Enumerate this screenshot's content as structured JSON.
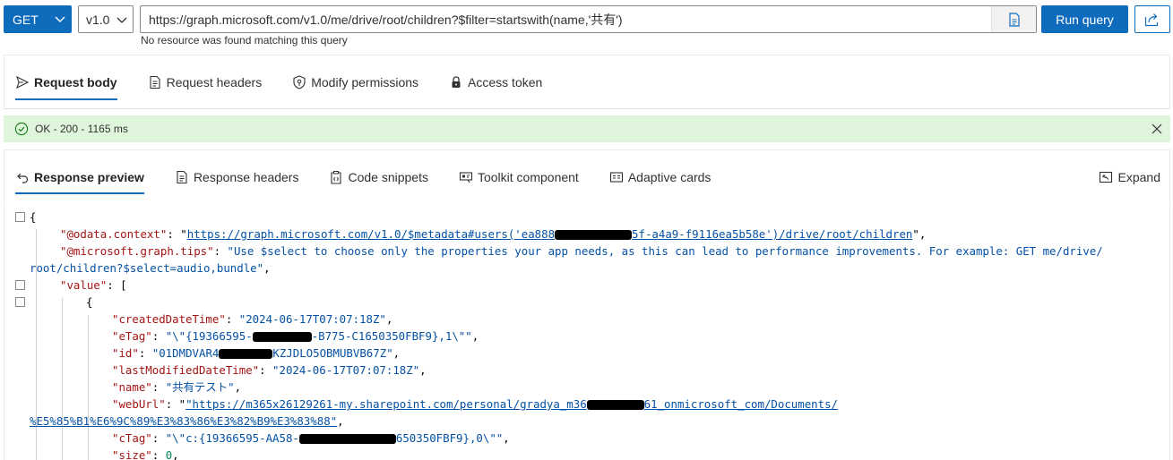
{
  "query": {
    "method": "GET",
    "version": "v1.0",
    "url": "https://graph.microsoft.com/v1.0/me/drive/root/children?$filter=startswith(name,'共有')",
    "hint": "No resource was found matching this query",
    "run_label": "Run query"
  },
  "request_tabs": [
    {
      "label": "Request body",
      "icon": "send-icon",
      "active": true
    },
    {
      "label": "Request headers",
      "icon": "document-icon",
      "active": false
    },
    {
      "label": "Modify permissions",
      "icon": "shield-key-icon",
      "active": false
    },
    {
      "label": "Access token",
      "icon": "lock-icon",
      "active": false
    }
  ],
  "status": {
    "text": "OK - 200 - 1165 ms",
    "color": "#dff6dd"
  },
  "response_tabs": [
    {
      "label": "Response preview",
      "icon": "undo-arrow-icon",
      "active": true
    },
    {
      "label": "Response headers",
      "icon": "document-icon",
      "active": false
    },
    {
      "label": "Code snippets",
      "icon": "code-clipboard-icon",
      "active": false
    },
    {
      "label": "Toolkit component",
      "icon": "toolkit-icon",
      "active": false
    },
    {
      "label": "Adaptive cards",
      "icon": "card-icon",
      "active": false
    }
  ],
  "expand_label": "Expand",
  "response": {
    "l1_brace": "{",
    "context_key": "\"@odata.context\"",
    "context_val_a": "https://graph.microsoft.com/v1.0/$metadata#users('ea888",
    "context_val_b": "5f-a4a9-f9116ea5b58e')/drive/root/children",
    "tips_key": "\"@microsoft.graph.tips\"",
    "tips_val_1": "\"Use $select to choose only the properties your app needs, as this can lead to performance improvements. For example: GET me/drive/",
    "tips_val_2": "root/children?$select=audio,bundle\"",
    "value_key": "\"value\"",
    "value_open": "[",
    "obj_open": "{",
    "created_key": "\"createdDateTime\"",
    "created_val": "\"2024-06-17T07:07:18Z\"",
    "etag_key": "\"eTag\"",
    "etag_val_a": "\"\\\"{19366595-",
    "etag_val_b": "-B775-C1650350FBF9},1\\\"\"",
    "id_key": "\"id\"",
    "id_val_a": "\"01DMDVAR4",
    "id_val_b": "KZJDLO5OBMUBVB67Z\"",
    "lastmod_key": "\"lastModifiedDateTime\"",
    "lastmod_val": "\"2024-06-17T07:07:18Z\"",
    "name_key": "\"name\"",
    "name_val": "\"共有テスト\"",
    "weburl_key": "\"webUrl\"",
    "weburl_val_a": "\"https://m365x26129261-my.sharepoint.com/personal/gradya_m36",
    "weburl_val_b": "61_onmicrosoft_com/Documents/",
    "weburl_val_c": "%E5%85%B1%E6%9C%89%E3%83%86%E3%82%B9%E3%83%88\"",
    "ctag_key": "\"cTag\"",
    "ctag_val_a": "\"\\\"c:{19366595-AA58-",
    "ctag_val_b": "650350FBF9},0\\\"\"",
    "size_key": "\"size\"",
    "size_val": "0"
  }
}
